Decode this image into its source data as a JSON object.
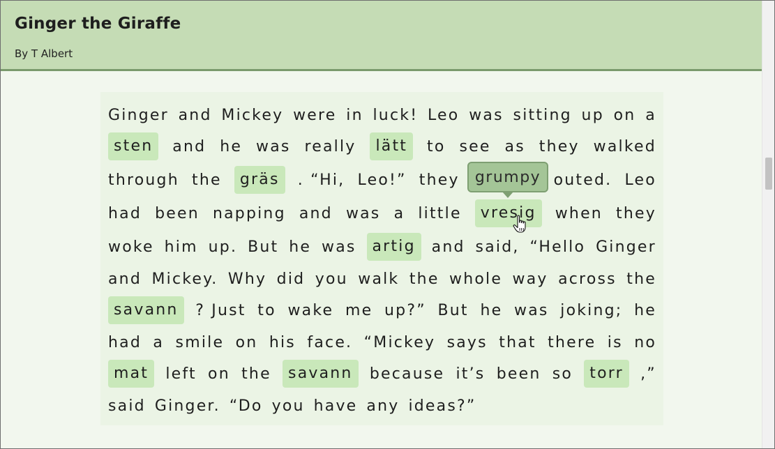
{
  "header": {
    "title": "Ginger the Giraffe",
    "author": "By T Albert"
  },
  "story": {
    "lines": [
      [
        {
          "t": "Ginger"
        },
        {
          "t": "and"
        },
        {
          "t": "Mickey"
        },
        {
          "t": "were"
        },
        {
          "t": "in"
        },
        {
          "t": "luck!"
        },
        {
          "t": "Leo"
        },
        {
          "t": "was"
        },
        {
          "t": "sitting"
        },
        {
          "t": "up"
        },
        {
          "t": "on"
        },
        {
          "t": "a"
        }
      ],
      [
        {
          "t": "sten",
          "chip": true
        },
        {
          "t": "and"
        },
        {
          "t": "he"
        },
        {
          "t": "was"
        },
        {
          "t": "really"
        },
        {
          "t": "lätt",
          "chip": true
        },
        {
          "t": "to"
        },
        {
          "t": "see"
        },
        {
          "t": "as"
        },
        {
          "t": "they"
        },
        {
          "t": "walked"
        }
      ],
      [
        {
          "t": "through"
        },
        {
          "t": "the"
        },
        {
          "t": "gräs",
          "chip": true
        },
        {
          "t": ". “Hi,"
        },
        {
          "t": "Leo!”"
        },
        {
          "t": "they"
        },
        {
          "t": "grumpy",
          "hidden": true
        },
        {
          "t": "outed."
        },
        {
          "t": "Leo"
        }
      ],
      [
        {
          "t": "had"
        },
        {
          "t": "been"
        },
        {
          "t": "napping"
        },
        {
          "t": "and"
        },
        {
          "t": "was"
        },
        {
          "t": "a"
        },
        {
          "t": "little"
        },
        {
          "t": "vresig",
          "chip": true
        },
        {
          "t": "when"
        },
        {
          "t": "they"
        }
      ],
      [
        {
          "t": "woke"
        },
        {
          "t": "him"
        },
        {
          "t": "up."
        },
        {
          "t": "But"
        },
        {
          "t": "he"
        },
        {
          "t": "was"
        },
        {
          "t": "artig",
          "chip": true
        },
        {
          "t": "and"
        },
        {
          "t": "said,"
        },
        {
          "t": "“Hello"
        },
        {
          "t": "Ginger"
        }
      ],
      [
        {
          "t": "and"
        },
        {
          "t": "Mickey."
        },
        {
          "t": "Why"
        },
        {
          "t": "did"
        },
        {
          "t": "you"
        },
        {
          "t": "walk"
        },
        {
          "t": "the"
        },
        {
          "t": "whole"
        },
        {
          "t": "way"
        },
        {
          "t": "across"
        },
        {
          "t": "the"
        }
      ],
      [
        {
          "t": "savann",
          "chip": true
        },
        {
          "t": "? Just"
        },
        {
          "t": "to"
        },
        {
          "t": "wake"
        },
        {
          "t": "me"
        },
        {
          "t": "up?”"
        },
        {
          "t": "But"
        },
        {
          "t": "he"
        },
        {
          "t": "was"
        },
        {
          "t": "joking;"
        },
        {
          "t": "he"
        }
      ],
      [
        {
          "t": "had"
        },
        {
          "t": "a"
        },
        {
          "t": "smile"
        },
        {
          "t": "on"
        },
        {
          "t": "his"
        },
        {
          "t": "face."
        },
        {
          "t": "“Mickey"
        },
        {
          "t": "says"
        },
        {
          "t": "that"
        },
        {
          "t": "there"
        },
        {
          "t": "is"
        },
        {
          "t": "no"
        }
      ],
      [
        {
          "t": "mat",
          "chip": true
        },
        {
          "t": "left"
        },
        {
          "t": "on"
        },
        {
          "t": "the"
        },
        {
          "t": "savann",
          "chip": true
        },
        {
          "t": "because"
        },
        {
          "t": "it’s"
        },
        {
          "t": "been"
        },
        {
          "t": "so"
        },
        {
          "t": "torr",
          "chip": true
        },
        {
          "t": ",”"
        }
      ],
      [
        {
          "t": "said"
        },
        {
          "t": "Ginger."
        },
        {
          "t": "“Do"
        },
        {
          "t": "you"
        },
        {
          "t": "have"
        },
        {
          "t": "any"
        },
        {
          "t": "ideas?”"
        }
      ]
    ]
  },
  "tooltip": {
    "text": "grumpy"
  },
  "colors": {
    "header": "#c5dcb5",
    "chip": "#c9e8ba",
    "tooltip": "#a4c597",
    "background": "#f2f7ee"
  },
  "icons": {
    "cursor": "hand-pointer-icon"
  }
}
